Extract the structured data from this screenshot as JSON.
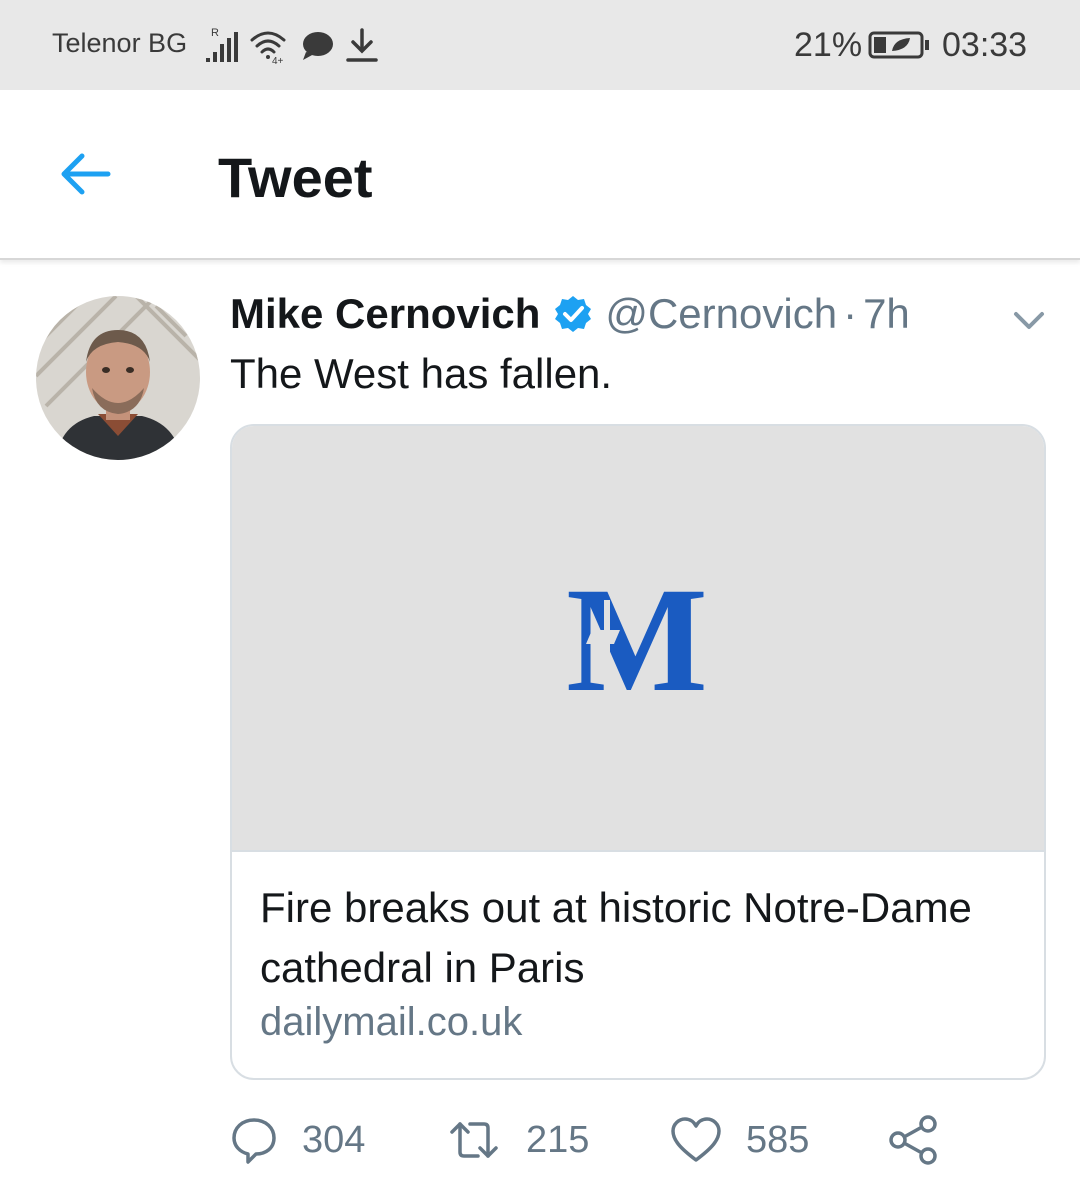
{
  "status_bar": {
    "carrier": "Telenor BG",
    "roaming_mark": "R",
    "network_tag": "4+",
    "battery_percent": "21%",
    "time": "03:33",
    "icons": [
      "signal-icon",
      "wifi-icon",
      "message-icon",
      "download-icon",
      "battery-icon"
    ]
  },
  "header": {
    "title": "Tweet",
    "back_icon": "back-arrow-icon",
    "accent_color": "#1da1f2"
  },
  "tweet": {
    "author_name": "Mike Cernovich",
    "verified": true,
    "handle": "@Cernovich",
    "separator": "·",
    "time": "7h",
    "text": "The West has fallen.",
    "card": {
      "logo_letter": "M",
      "logo_color": "#1a5bc1",
      "title": "Fire breaks out at historic Notre-Dame cathedral in Paris",
      "domain": "dailymail.co.uk"
    },
    "actions": {
      "replies": "304",
      "retweets": "215",
      "likes": "585"
    }
  }
}
